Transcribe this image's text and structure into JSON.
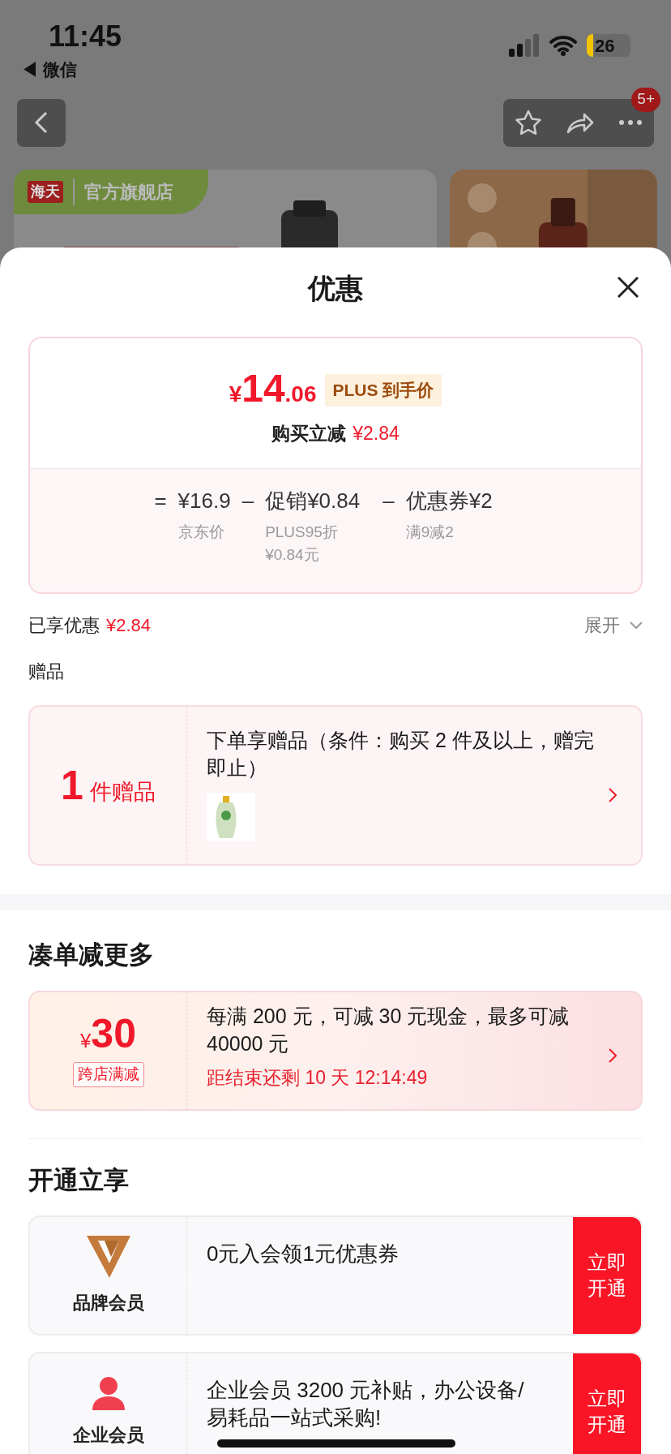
{
  "status_bar": {
    "time": "11:45",
    "back_app": "◀ 微信",
    "battery": "26"
  },
  "nav": {
    "badge": "5+"
  },
  "banner": {
    "logo": "海天",
    "store": "官方旗舰店"
  },
  "sheet": {
    "title": "优惠"
  },
  "price": {
    "currency": "¥",
    "integer": "14",
    "decimal": ".06",
    "tag": "PLUS 到手价",
    "saving_label": "购买立减",
    "saving": "¥2.84",
    "breakdown": [
      {
        "op": "=",
        "amount": "¥16.9",
        "notes": [
          "京东价"
        ]
      },
      {
        "op": "–",
        "amount": "促销¥0.84",
        "notes": [
          "PLUS95折",
          "¥0.84元"
        ]
      },
      {
        "op": "–",
        "amount": "优惠券¥2",
        "notes": [
          "满9减2"
        ]
      }
    ]
  },
  "applied": {
    "label": "已享优惠",
    "amount": "¥2.84",
    "expand": "展开"
  },
  "gifts": {
    "heading": "赠品",
    "count": "1",
    "count_label": "件赠品",
    "text": "下单享赠品（条件：购买 2 件及以上，赠完即止）"
  },
  "bundle": {
    "heading": "凑单减更多",
    "currency": "¥",
    "amount": "30",
    "tag": "跨店满减",
    "text": "每满 200 元，可减 30 元现金，最多可减 40000 元",
    "countdown": "距结束还剩 10 天 12:14:49"
  },
  "membership": {
    "heading": "开通立享",
    "items": [
      {
        "kind": "brand",
        "name": "品牌会员",
        "text": "0元入会领1元优惠券",
        "button": "立即开通"
      },
      {
        "kind": "enterprise",
        "name": "企业会员",
        "text": "企业会员 3200 元补贴，办公设备/易耗品一站式采购!",
        "button": "立即开通"
      }
    ]
  }
}
